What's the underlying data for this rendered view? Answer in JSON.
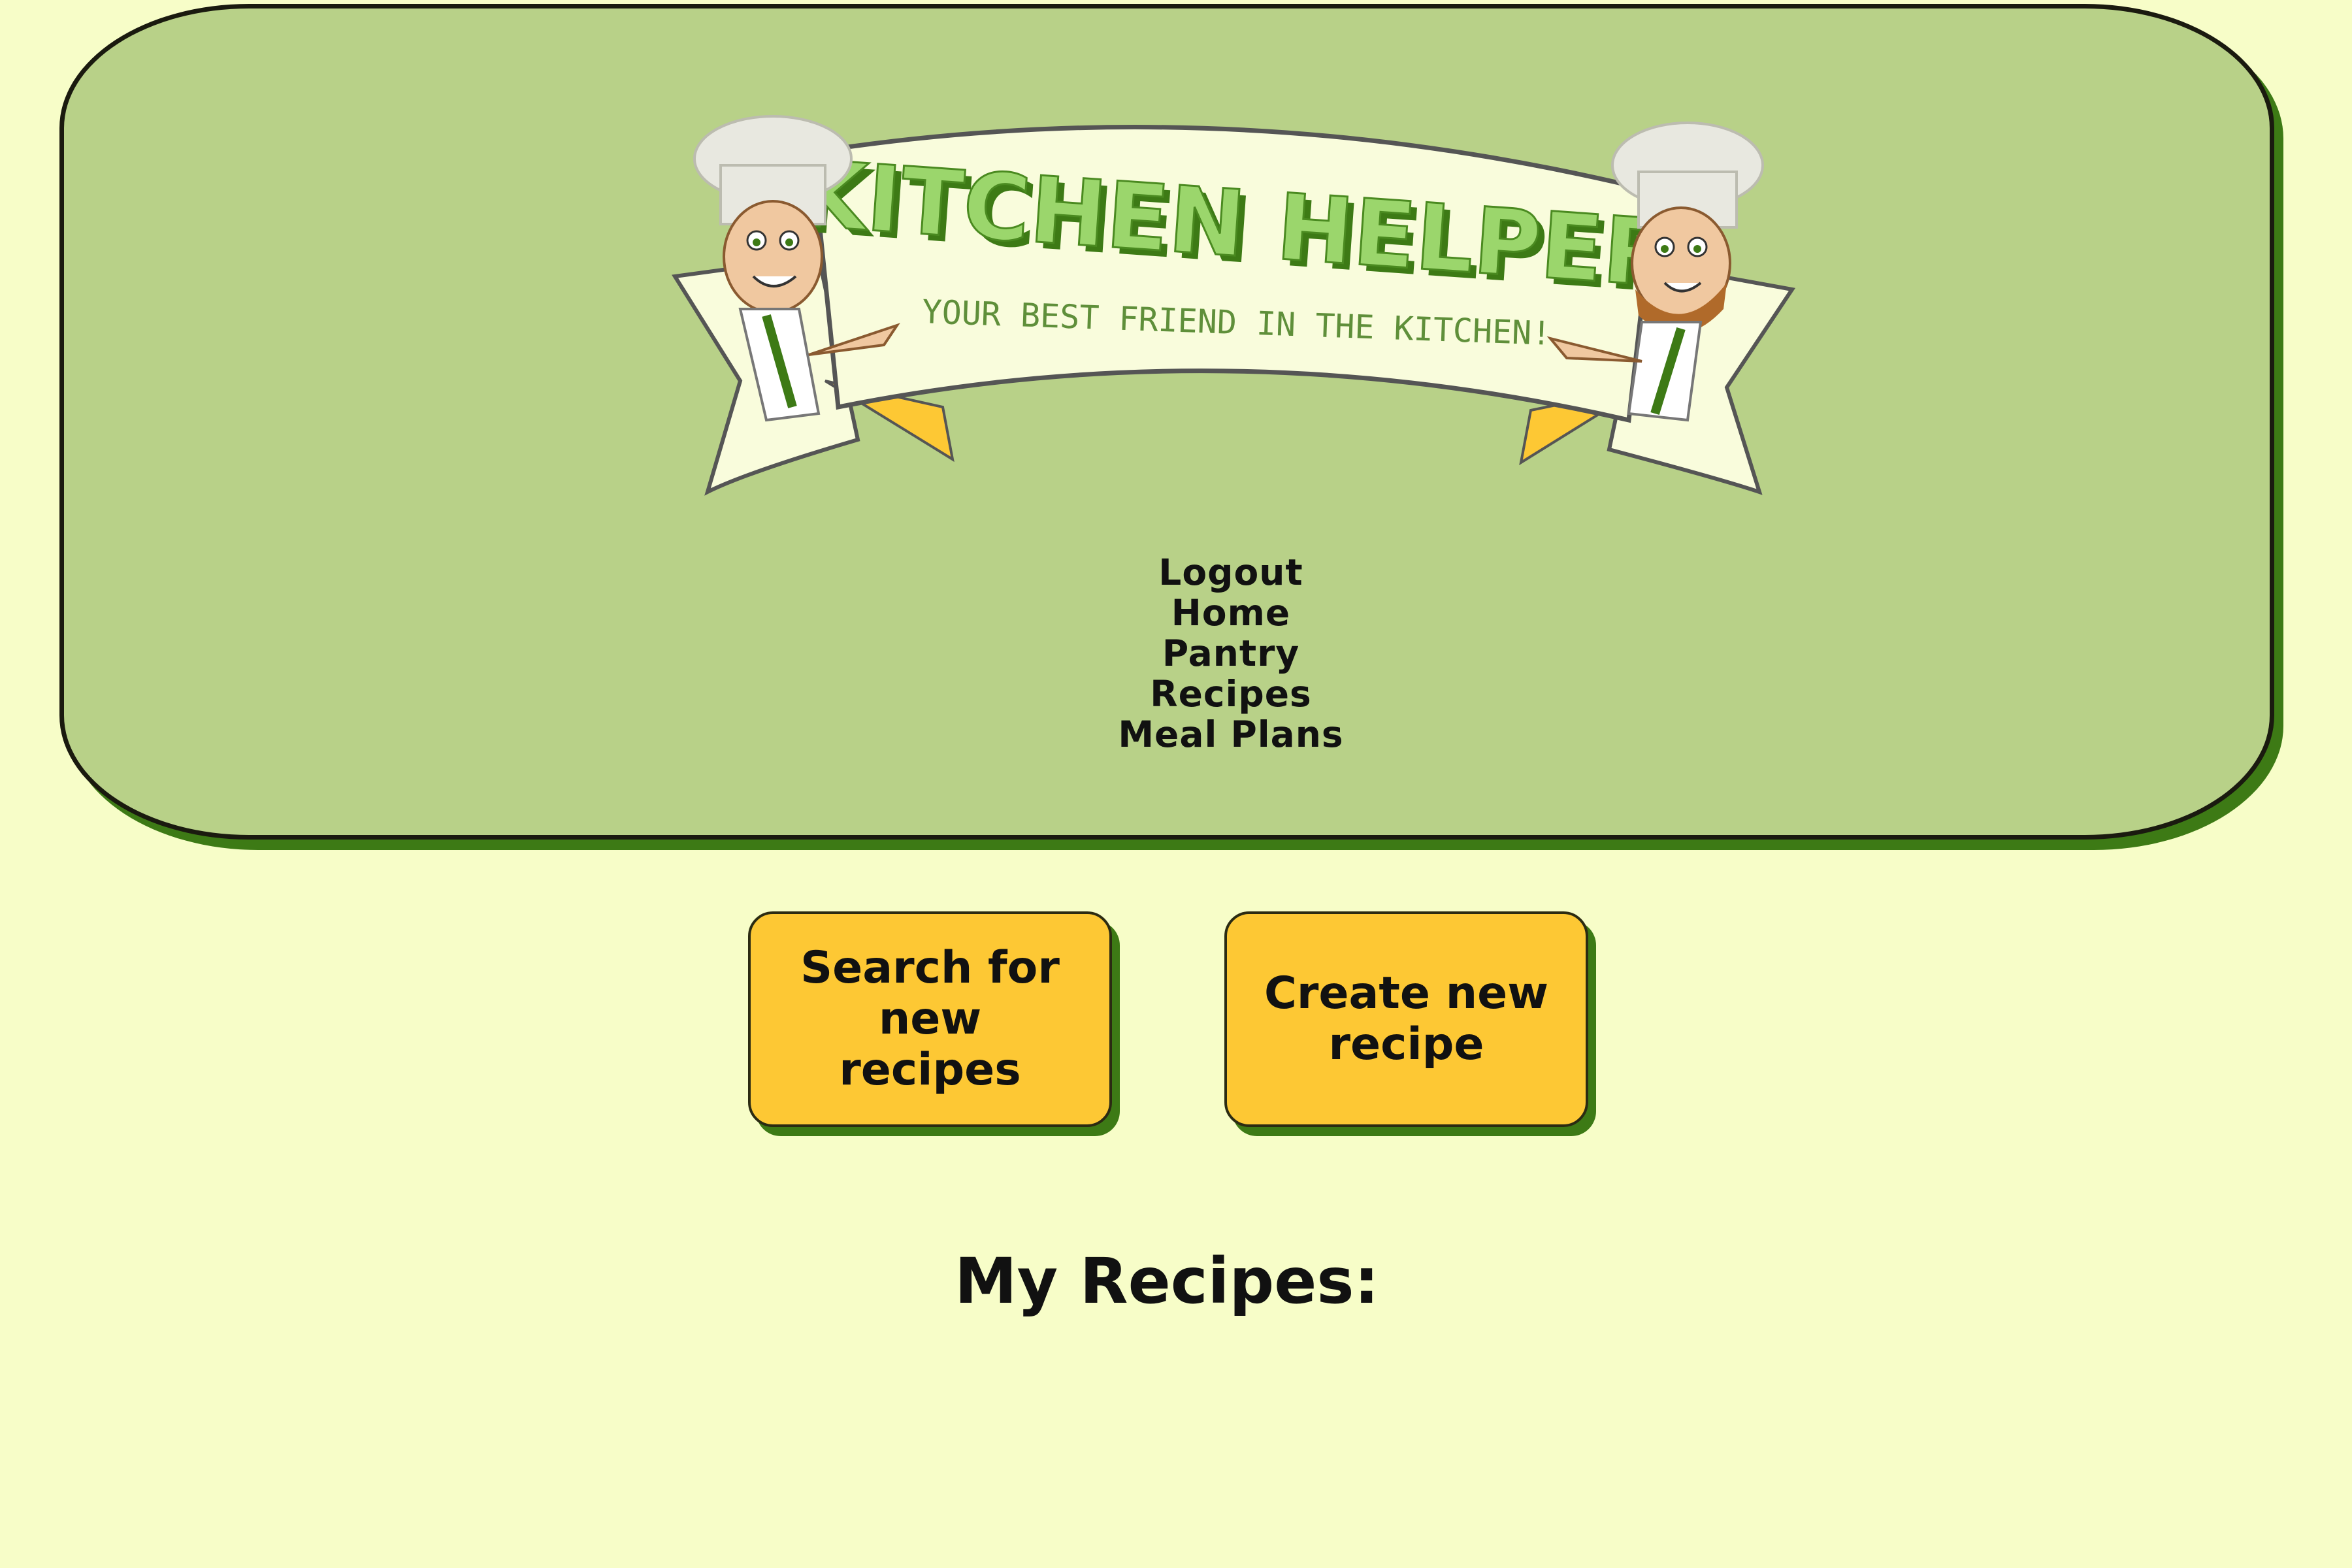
{
  "logo": {
    "title": "KITCHEN HELPER",
    "tagline": "YOUR BEST FRIEND IN THE KITCHEN!"
  },
  "nav": {
    "items": [
      {
        "label": "Logout"
      },
      {
        "label": "Home"
      },
      {
        "label": "Pantry"
      },
      {
        "label": "Recipes"
      },
      {
        "label": "Meal Plans"
      }
    ]
  },
  "actions": {
    "search_label": "Search for new recipes",
    "create_label": "Create new recipe"
  },
  "main": {
    "section_title": "My Recipes:"
  },
  "colors": {
    "page_background": "#f7fdc8",
    "header_background": "#b8d188",
    "button_background": "#fdc834",
    "shadow": "#3d7a15",
    "logo_title": "#8fd16a",
    "banner": "#f9fcdc"
  },
  "icons": {
    "left_chef": "chef-icon",
    "right_chef": "chef-icon"
  }
}
